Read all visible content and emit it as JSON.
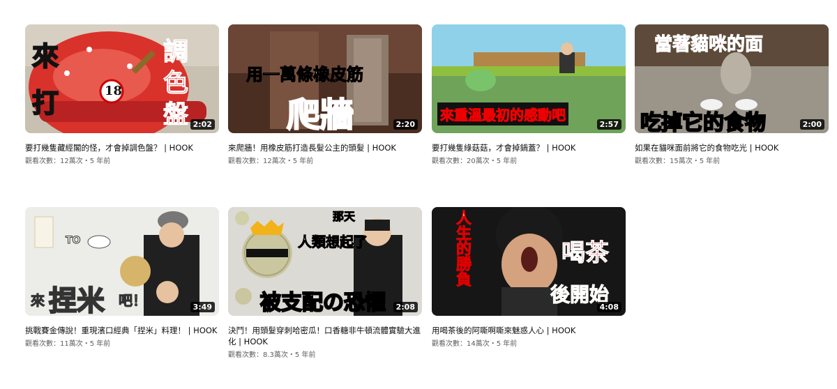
{
  "videos": [
    {
      "title": "要打幾隻藏經閣的怪，才會掉調色盤？ | HOOK",
      "duration": "2:02",
      "meta": "觀看次數：12萬次・5 年前",
      "thumb_text": {
        "a": "來",
        "b": "打",
        "c": "調",
        "d": "色",
        "e": "盤",
        "badge": "18"
      }
    },
    {
      "title": "來爬牆！用橡皮筋打造長髮公主的頭髮 | HOOK",
      "duration": "2:20",
      "meta": "觀看次數：12萬次・5 年前",
      "thumb_text": {
        "top": "用一萬條橡皮筋",
        "big": "爬牆"
      }
    },
    {
      "title": "要打幾隻綠菇菇，才會掉鍋蓋？ | HOOK",
      "duration": "2:57",
      "meta": "觀看次數：20萬次・5 年前",
      "thumb_text": {
        "banner": "來重溫最初的感動吧"
      }
    },
    {
      "title": "如果在貓咪面前將它的食物吃光 | HOOK",
      "duration": "2:00",
      "meta": "觀看次數：15萬次・5 年前",
      "thumb_text": {
        "top": "當著貓咪的面",
        "bottom": "吃掉它的食物"
      }
    },
    {
      "title": "挑戰賽金傳說！重現濱口經典「捏米」料理！ | HOOK",
      "duration": "3:49",
      "meta": "觀看次數：11萬次・5 年前",
      "thumb_text": {
        "to": "TO",
        "a": "來",
        "big": "捏米",
        "c": "吧！"
      }
    },
    {
      "title": "決鬥！用頭髮穿刺哈密瓜！口香糖非牛頓流體實驗大進化 | HOOK",
      "duration": "2:08",
      "meta": "觀看次數：8.3萬次・5 年前",
      "thumb_text": {
        "top": "那天",
        "mid": "人類想起了",
        "bottom": "被支配の恐懼"
      }
    },
    {
      "title": "用喝茶後的阿嘶啊嘶來魅惑人心 | HOOK",
      "duration": "4:08",
      "meta": "觀看次數：14萬次・5 年前",
      "thumb_text": {
        "left": "人生的勝負",
        "right1": "喝茶",
        "right2": "後開始"
      }
    }
  ]
}
